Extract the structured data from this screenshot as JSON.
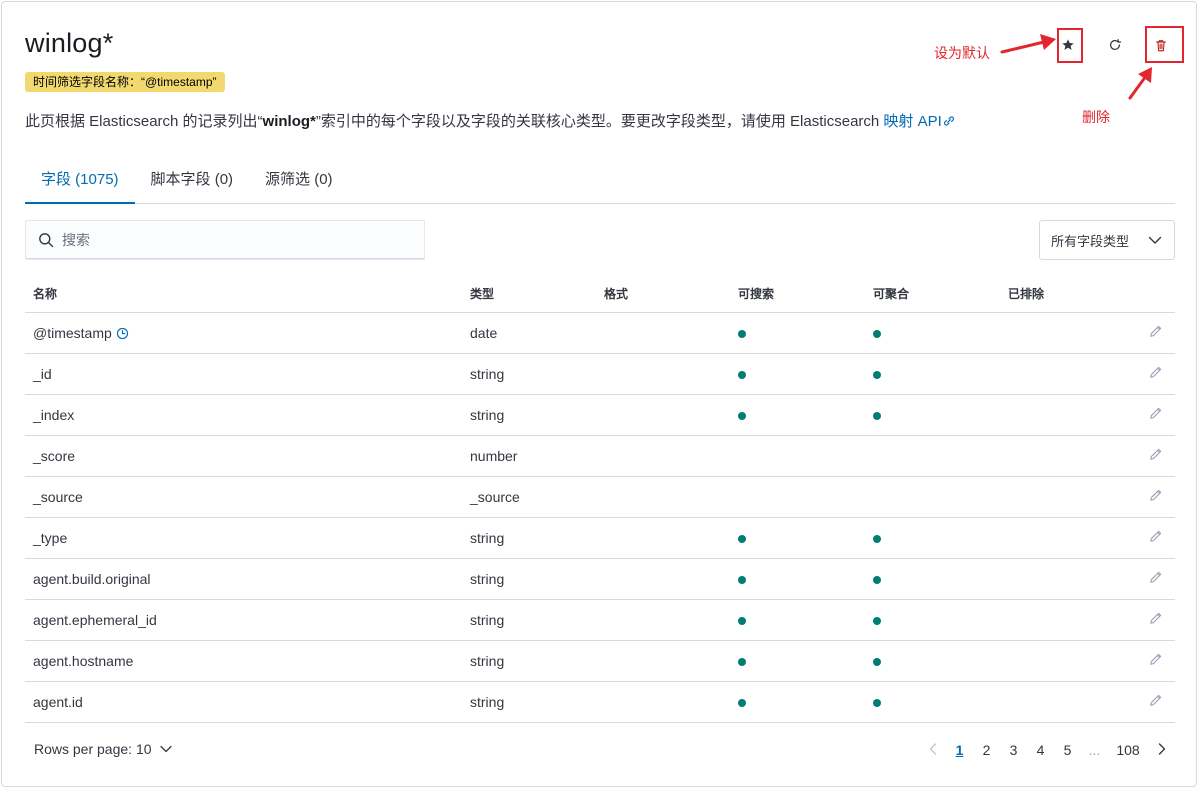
{
  "header": {
    "title": "winlog*",
    "time_field_badge": "时间筛选字段名称：“@timestamp”",
    "description_pre": "此页根据 Elasticsearch 的记录列出“",
    "description_bold": "winlog*",
    "description_post": "”索引中的每个字段以及字段的关联核心类型。要更改字段类型，请使用 Elasticsearch ",
    "description_link": "映射 API"
  },
  "annotations": {
    "set_default": "设为默认",
    "delete": "删除",
    "color": "#e3262d"
  },
  "tabs": [
    {
      "label": "字段 (1075)",
      "active": true
    },
    {
      "label": "脚本字段 (0)",
      "active": false
    },
    {
      "label": "源筛选 (0)",
      "active": false
    }
  ],
  "search": {
    "placeholder": "搜索"
  },
  "type_filter": {
    "selected": "所有字段类型"
  },
  "table": {
    "columns": [
      "名称",
      "类型",
      "格式",
      "可搜索",
      "可聚合",
      "已排除"
    ],
    "rows": [
      {
        "name": "@timestamp",
        "type": "date",
        "format": "",
        "searchable": true,
        "aggregatable": true,
        "time_field": true
      },
      {
        "name": "_id",
        "type": "string",
        "format": "",
        "searchable": true,
        "aggregatable": true
      },
      {
        "name": "_index",
        "type": "string",
        "format": "",
        "searchable": true,
        "aggregatable": true
      },
      {
        "name": "_score",
        "type": "number",
        "format": "",
        "searchable": false,
        "aggregatable": false
      },
      {
        "name": "_source",
        "type": "_source",
        "format": "",
        "searchable": false,
        "aggregatable": false
      },
      {
        "name": "_type",
        "type": "string",
        "format": "",
        "searchable": true,
        "aggregatable": true
      },
      {
        "name": "agent.build.original",
        "type": "string",
        "format": "",
        "searchable": true,
        "aggregatable": true
      },
      {
        "name": "agent.ephemeral_id",
        "type": "string",
        "format": "",
        "searchable": true,
        "aggregatable": true
      },
      {
        "name": "agent.hostname",
        "type": "string",
        "format": "",
        "searchable": true,
        "aggregatable": true
      },
      {
        "name": "agent.id",
        "type": "string",
        "format": "",
        "searchable": true,
        "aggregatable": true
      }
    ]
  },
  "footer": {
    "rows_per_page": "Rows per page: 10",
    "pages": [
      "1",
      "2",
      "3",
      "4",
      "5"
    ],
    "ellipsis": "...",
    "last_page": "108",
    "current_page": 1
  },
  "colors": {
    "accent": "#006bb4",
    "dot": "#017d73",
    "badge": "#f1d86f"
  }
}
